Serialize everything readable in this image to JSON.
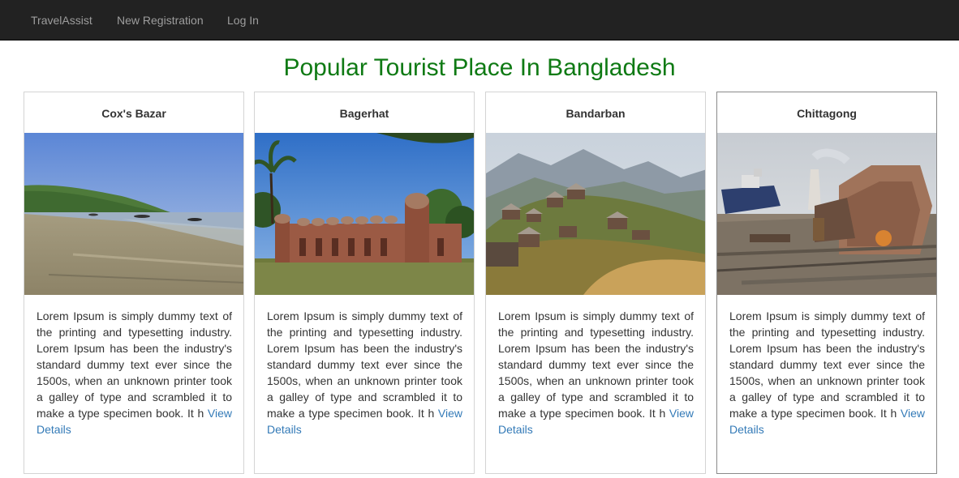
{
  "navbar": {
    "brand": "TravelAssist",
    "links": [
      {
        "label": "New Registration"
      },
      {
        "label": "Log In"
      }
    ]
  },
  "page": {
    "title": "Popular Tourist Place In Bangladesh"
  },
  "cards": [
    {
      "title": "Cox's Bazar",
      "description": "Lorem Ipsum is simply dummy text of the printing and typesetting industry. Lorem Ipsum has been the industry's standard dummy text ever since the 1500s, when an unknown printer took a galley of type and scrambled it to make a type specimen book. It h ",
      "link_label": "View Details",
      "image": "beach-photo"
    },
    {
      "title": "Bagerhat",
      "description": "Lorem Ipsum is simply dummy text of the printing and typesetting industry. Lorem Ipsum has been the industry's standard dummy text ever since the 1500s, when an unknown printer took a galley of type and scrambled it to make a type specimen book. It h ",
      "link_label": "View Details",
      "image": "mosque-photo"
    },
    {
      "title": "Bandarban",
      "description": "Lorem Ipsum is simply dummy text of the printing and typesetting industry. Lorem Ipsum has been the industry's standard dummy text ever since the 1500s, when an unknown printer took a galley of type and scrambled it to make a type specimen book. It h ",
      "link_label": "View Details",
      "image": "hill-village-photo"
    },
    {
      "title": "Chittagong",
      "description": "Lorem Ipsum is simply dummy text of the printing and typesetting industry. Lorem Ipsum has been the industry's standard dummy text ever since the 1500s, when an unknown printer took a galley of type and scrambled it to make a type specimen book. It h ",
      "link_label": "View Details",
      "image": "shipyard-photo"
    }
  ],
  "colors": {
    "navbar_bg": "#222222",
    "nav_text": "#9d9d9d",
    "title_green": "#0f7a14",
    "link_blue": "#337ab7"
  }
}
